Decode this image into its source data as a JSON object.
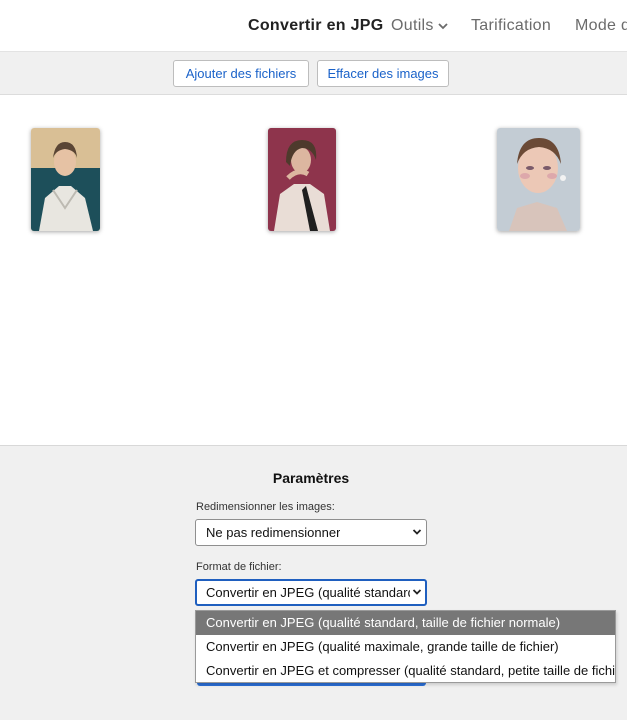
{
  "nav": {
    "items": [
      {
        "label": "Convertir en JPG"
      },
      {
        "label": "Outils"
      },
      {
        "label": "Tarification"
      },
      {
        "label": "Mode d"
      }
    ]
  },
  "toolbar": {
    "add_files_label": "Ajouter des fichiers",
    "clear_images_label": "Effacer des images"
  },
  "gallery": {
    "thumbnails": [
      {
        "name": "image-thumbnail-1"
      },
      {
        "name": "image-thumbnail-2"
      },
      {
        "name": "image-thumbnail-3"
      }
    ]
  },
  "settings": {
    "title": "Paramètres",
    "resize": {
      "label": "Redimensionner les images:",
      "value": "Ne pas redimensionner"
    },
    "format": {
      "label": "Format de fichier:",
      "value": "Convertir en JPEG (qualité standard,",
      "options": [
        "Convertir en JPEG (qualité standard, taille de fichier normale)",
        "Convertir en JPEG (qualité maximale, grande taille de fichier)",
        "Convertir en JPEG et compresser (qualité standard, petite taille de fichier)"
      ],
      "selected_index": 0
    }
  },
  "colors": {
    "accent": "#1a62c9",
    "focus": "#1f5fbf",
    "option_selected_bg": "#777777"
  }
}
